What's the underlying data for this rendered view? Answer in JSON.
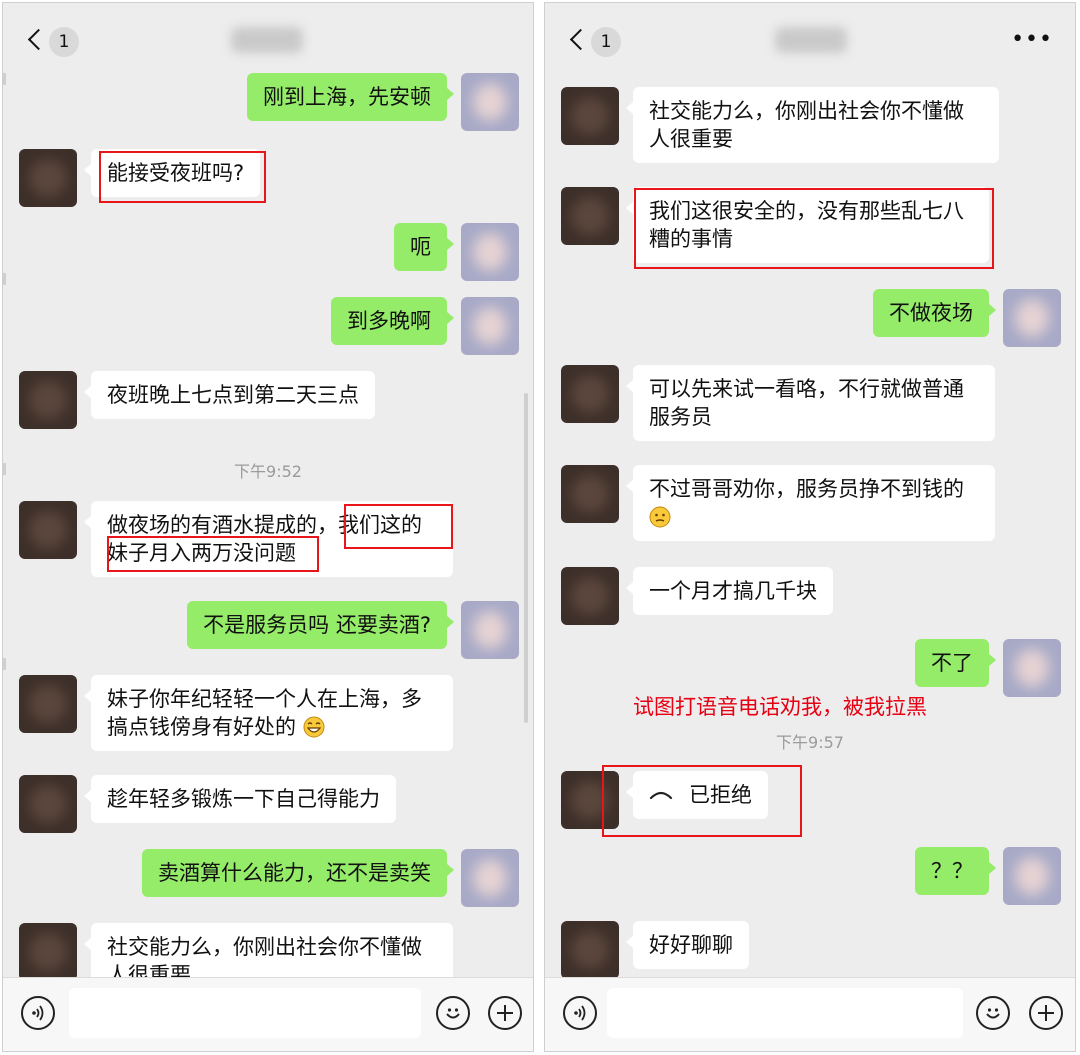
{
  "left": {
    "nav": {
      "back_count": "1"
    },
    "time_label": "下午9:52",
    "messages": [
      {
        "text": "刚到上海，先安顿"
      },
      {
        "text": "能接受夜班吗?"
      },
      {
        "text": "呃"
      },
      {
        "text": "到多晚啊"
      },
      {
        "text": "夜班晚上七点到第二天三点"
      },
      {
        "text": "做夜场的有酒水提成的，我们这的妹子月入两万没问题"
      },
      {
        "text": "不是服务员吗 还要卖酒?"
      },
      {
        "text": "妹子你年纪轻轻一个人在上海，多搞点钱傍身有好处的"
      },
      {
        "text": "趁年轻多锻炼一下自己得能力"
      },
      {
        "text": "卖酒算什么能力，还不是卖笑"
      },
      {
        "text": "社交能力么，你刚出社会你不懂做人很重要"
      }
    ]
  },
  "right": {
    "nav": {
      "back_count": "1"
    },
    "annotation": "试图打语音电话劝我，被我拉黑",
    "time_label": "下午9:57",
    "call_status": "已拒绝",
    "messages": [
      {
        "text": "社交能力么，你刚出社会你不懂做人很重要"
      },
      {
        "text": "我们这很安全的，没有那些乱七八糟的事情"
      },
      {
        "text": "不做夜场"
      },
      {
        "text": "可以先来试一看咯，不行就做普通服务员"
      },
      {
        "text": "不过哥哥劝你，服务员挣不到钱的"
      },
      {
        "text": "一个月才搞几千块"
      },
      {
        "text": "不了"
      },
      {
        "text": "？？"
      },
      {
        "text": "好好聊聊"
      }
    ]
  },
  "icons": {
    "back": "chevron-left-icon",
    "more": "more-dots-icon",
    "voice": "voice-input-icon",
    "emoji": "emoji-icon",
    "plus": "plus-icon",
    "grin": "grinning-emoji-icon",
    "smirk": "awkward-emoji-icon",
    "call": "phone-hangup-icon"
  },
  "colors": {
    "chat_bg": "#ededed",
    "outgoing_bubble": "#95ec69",
    "incoming_bubble": "#ffffff",
    "highlight_box": "#e8151b",
    "annotation_text": "#e60012"
  }
}
